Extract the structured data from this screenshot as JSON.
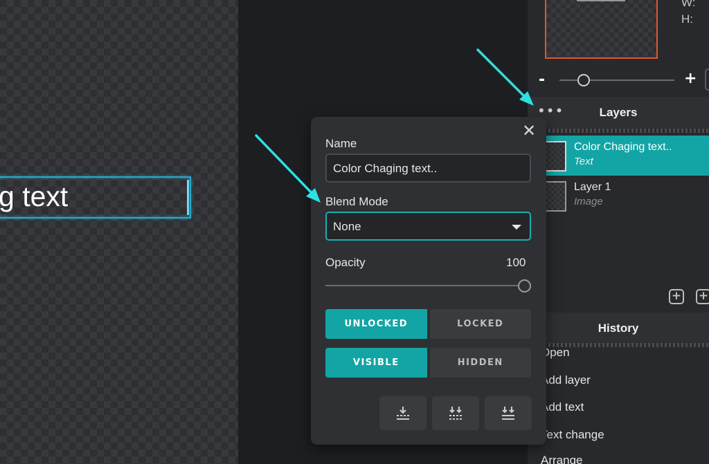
{
  "canvas": {
    "text_content": "g text"
  },
  "preview": {
    "w_label": "W:",
    "h_label": "H:"
  },
  "zoom": {
    "minus": "-",
    "plus": "+"
  },
  "layers": {
    "title": "Layers",
    "menu_dots": "•••",
    "items": [
      {
        "name": "Color Chaging text..",
        "type": "Text",
        "active": true
      },
      {
        "name": "Layer 1",
        "type": "Image",
        "active": false
      }
    ],
    "tools": [
      "add-layer-icon",
      "duplicate-layer-icon"
    ]
  },
  "history": {
    "title": "History",
    "items": [
      "Open",
      "Add layer",
      "Add text",
      "Text change",
      "Arrange"
    ]
  },
  "dialog": {
    "close": "✕",
    "name_label": "Name",
    "name_value": "Color Chaging text..",
    "blend_label": "Blend Mode",
    "blend_value": "None",
    "opacity_label": "Opacity",
    "opacity_value": "100",
    "opacity_fraction": 1.0,
    "lock": {
      "on": "UNLOCKED",
      "off": "LOCKED"
    },
    "visibility": {
      "on": "VISIBLE",
      "off": "HIDDEN"
    },
    "arrange_buttons": [
      "merge-down-icon",
      "merge-visible-icon",
      "flatten-icon"
    ]
  },
  "colors": {
    "accent": "#13a5a5",
    "annotation_arrow": "#2ee0e0",
    "selection_border": "#e2572a"
  }
}
